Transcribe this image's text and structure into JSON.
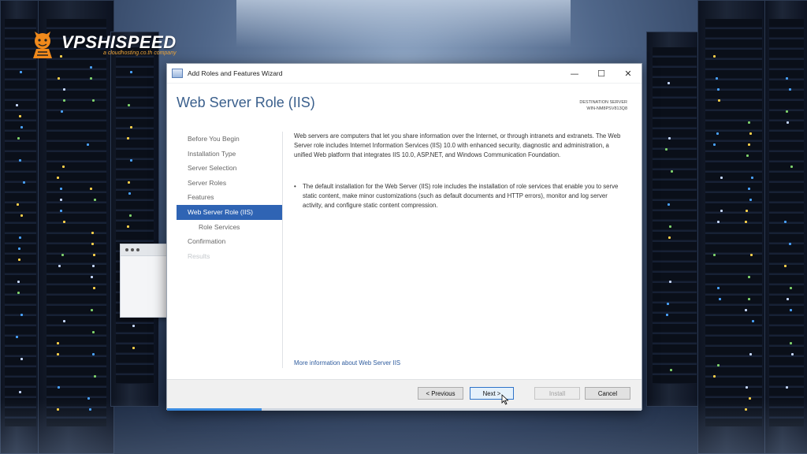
{
  "logo": {
    "name": "VPSHISPEED",
    "tagline": "a cloudhosting.co.th company",
    "accent_color": "#f0a63a"
  },
  "wizard": {
    "window_title": "Add Roles and Features Wizard",
    "window_controls": {
      "minimize": "—",
      "maximize": "☐",
      "close": "✕"
    },
    "page_title": "Web Server Role (IIS)",
    "destination_label": "DESTINATION SERVER",
    "destination_server": "WIN-NM8PSV813Q8",
    "nav_items": [
      {
        "label": "Before You Begin",
        "state": "normal"
      },
      {
        "label": "Installation Type",
        "state": "normal"
      },
      {
        "label": "Server Selection",
        "state": "normal"
      },
      {
        "label": "Server Roles",
        "state": "normal"
      },
      {
        "label": "Features",
        "state": "normal"
      },
      {
        "label": "Web Server Role (IIS)",
        "state": "active"
      },
      {
        "label": "Role Services",
        "state": "sub"
      },
      {
        "label": "Confirmation",
        "state": "normal"
      },
      {
        "label": "Results",
        "state": "disabled"
      }
    ],
    "intro_text": "Web servers are computers that let you share information over the Internet, or through intranets and extranets. The Web Server role includes Internet Information Services (IIS) 10.0 with enhanced security, diagnostic and administration, a unified Web platform that integrates IIS 10.0, ASP.NET, and Windows Communication Foundation.",
    "bullet_text": "The default installation for the Web Server (IIS) role includes the installation of role services that enable you to serve static content, make minor customizations (such as default documents and HTTP errors), monitor and log server activity, and configure static content compression.",
    "more_info_link": "More information about Web Server IIS",
    "buttons": {
      "previous": "< Previous",
      "next": "Next >",
      "install": "Install",
      "cancel": "Cancel"
    },
    "progress": 0.2,
    "accent_color": "#2f64b4",
    "title_color": "#3a5f8c"
  }
}
